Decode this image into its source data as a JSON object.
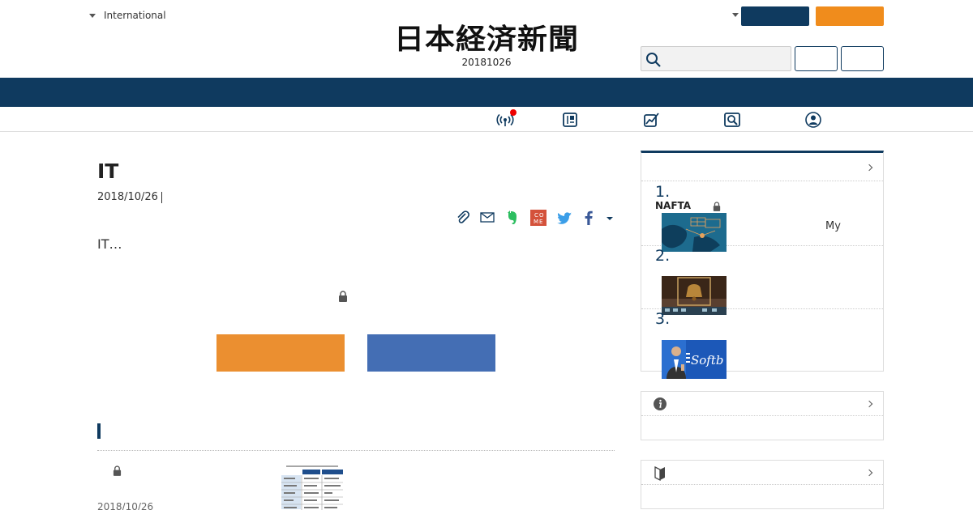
{
  "header": {
    "edition_label": "International",
    "logo": "日本経済新聞",
    "issue_date": "20181026",
    "search": {
      "placeholder": "",
      "value": ""
    }
  },
  "subnav": {
    "my_label": "My",
    "icons": [
      "broadcast-icon",
      "paper-edition-icon",
      "market-chart-icon",
      "search-magnifier-icon",
      "user-circle-icon"
    ]
  },
  "article": {
    "title": "IT",
    "date": "2018/10/26",
    "lead": "IT…",
    "share_icons": [
      "clip-icon",
      "mail-icon",
      "evernote-icon",
      "comemo-icon",
      "twitter-icon",
      "facebook-icon",
      "share-more-icon"
    ]
  },
  "related": {
    "items": [
      {
        "date": "2018/10/26"
      }
    ]
  },
  "ranking": {
    "items": [
      {
        "num": "1.",
        "title": "NAFTA"
      },
      {
        "num": "2.",
        "title": ""
      },
      {
        "num": "3.",
        "title": ""
      }
    ],
    "thumb3_text": "Softb"
  },
  "colors": {
    "navy": "#0f3a5f",
    "orange": "#f08c1c",
    "cta_orange": "#eb8f30",
    "cta_blue": "#446eb4",
    "notification_dot": "#e00000"
  }
}
